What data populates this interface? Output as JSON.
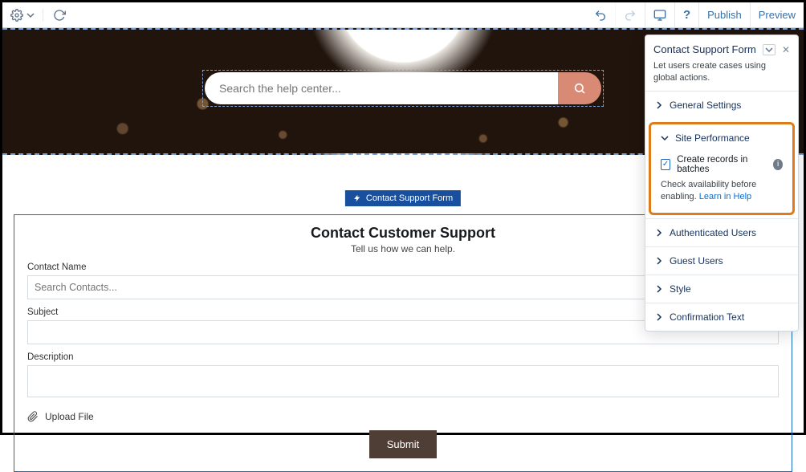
{
  "toolbar": {
    "publish": "Publish",
    "preview": "Preview"
  },
  "hero": {
    "search_placeholder": "Search the help center..."
  },
  "component_badge": "Contact Support Form",
  "form": {
    "title": "Contact Customer Support",
    "subtitle": "Tell us how we can help.",
    "contact_name_label": "Contact Name",
    "contact_name_placeholder": "Search Contacts...",
    "subject_label": "Subject",
    "description_label": "Description",
    "upload_label": "Upload File",
    "submit": "Submit"
  },
  "panel": {
    "title": "Contact Support Form",
    "subtitle": "Let users create cases using global actions.",
    "sections": {
      "general": "General Settings",
      "site_perf": "Site Performance",
      "auth_users": "Authenticated Users",
      "guest_users": "Guest Users",
      "style": "Style",
      "confirmation": "Confirmation Text"
    },
    "batches_label": "Create records in batches",
    "help_prefix": "Check availability before enabling. ",
    "help_link": "Learn in Help"
  }
}
